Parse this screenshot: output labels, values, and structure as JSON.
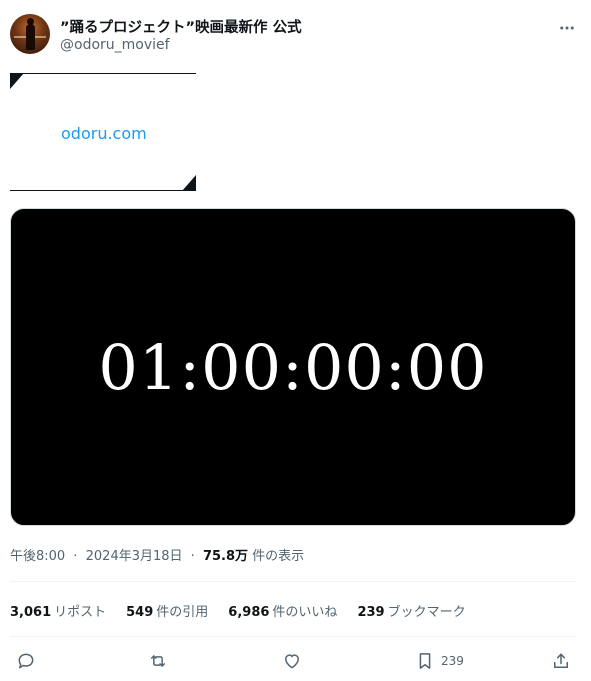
{
  "account": {
    "display_name": "”踊るプロジェクト”映画最新作 公式",
    "handle": "@odoru_movief"
  },
  "post": {
    "link_text": "odoru.com",
    "media_timecode": "01:00:00:00"
  },
  "meta": {
    "time": "午後8:00",
    "date": "2024年3月18日",
    "separator": "·",
    "views_count": "75.8万",
    "views_label": "件の表示"
  },
  "stats": [
    {
      "count": "3,061",
      "label": "リポスト"
    },
    {
      "count": "549",
      "label": "件の引用"
    },
    {
      "count": "6,986",
      "label": "件のいいね"
    },
    {
      "count": "239",
      "label": "ブックマーク"
    }
  ],
  "actions": {
    "bookmark_count": "239"
  },
  "colors": {
    "link": "#1d9bf0",
    "secondary_text": "#536471",
    "media_background": "#000000"
  },
  "icons": [
    "more-icon",
    "reply-icon",
    "retweet-icon",
    "like-icon",
    "bookmark-icon",
    "share-icon"
  ]
}
